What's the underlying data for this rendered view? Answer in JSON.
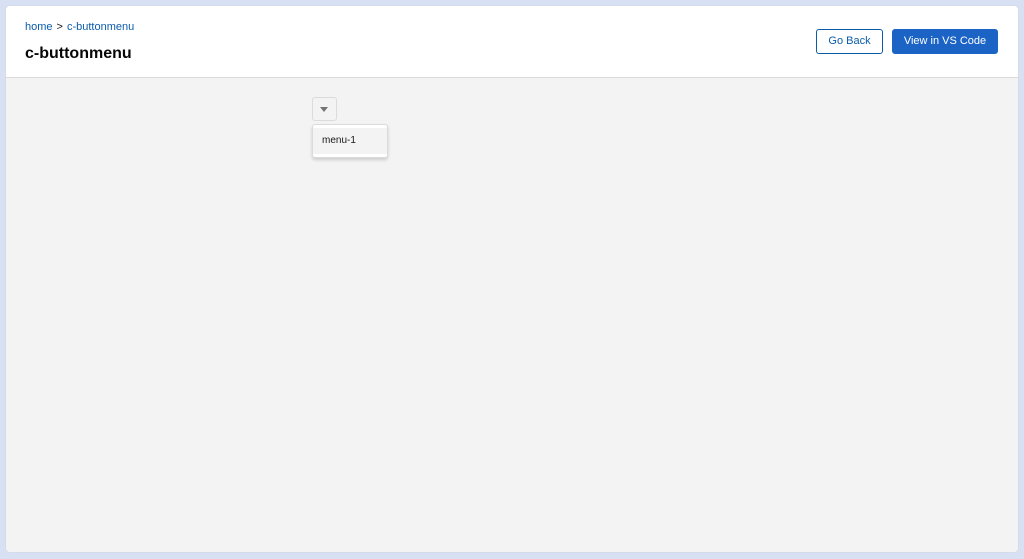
{
  "breadcrumb": {
    "home": "home",
    "separator": ">",
    "current": "c-buttonmenu"
  },
  "header": {
    "title": "c-buttonmenu",
    "go_back_label": "Go Back",
    "view_vscode_label": "View in VS Code"
  },
  "button_menu": {
    "trigger_icon": "chevron-down-icon",
    "items": [
      {
        "label": "menu-1"
      }
    ]
  },
  "colors": {
    "brand": "#1b64c6",
    "link": "#0b5cab",
    "background": "#f3f3f3"
  }
}
